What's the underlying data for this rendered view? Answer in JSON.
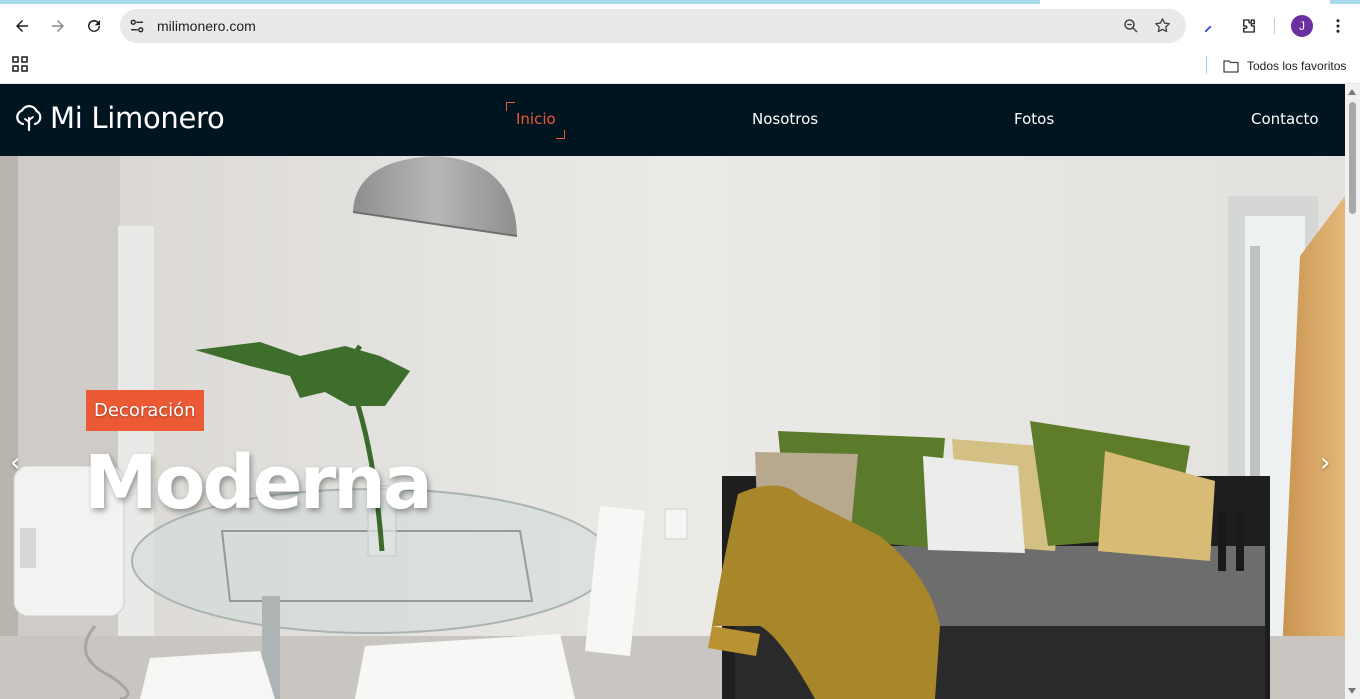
{
  "browser": {
    "url": "milimonero.com",
    "avatar_initial": "J",
    "bookmarks_folder": "Todos los favoritos",
    "icons": {
      "back": "arrow-left-icon",
      "forward": "arrow-right-icon",
      "reload": "reload-icon",
      "site_info": "tune-icon",
      "zoom": "zoom-icon",
      "bookmark": "star-icon",
      "extensions": "puzzle-icon",
      "menu": "kebab-menu-icon",
      "apps": "apps-grid-icon"
    }
  },
  "site": {
    "logo_text": "Mi Limonero",
    "nav": [
      {
        "label": "Inicio",
        "active": true
      },
      {
        "label": "Nosotros",
        "active": false
      },
      {
        "label": "Fotos",
        "active": false
      },
      {
        "label": "Contacto",
        "active": false
      }
    ],
    "hero": {
      "badge": "Decoración",
      "title": "Moderna",
      "prev_arrow": "‹",
      "next_arrow": "›"
    },
    "colors": {
      "header_bg": "#011520",
      "accent": "#eb5a35",
      "nav_text": "#ffffff"
    }
  }
}
